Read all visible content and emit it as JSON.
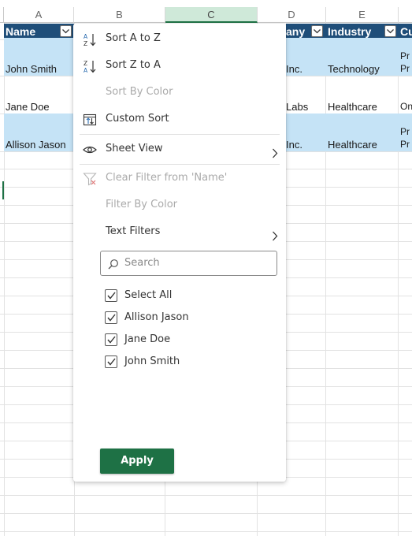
{
  "columns": [
    {
      "letter": "A",
      "active": false
    },
    {
      "letter": "B",
      "active": false
    },
    {
      "letter": "C",
      "active": true
    },
    {
      "letter": "D",
      "active": false
    },
    {
      "letter": "E",
      "active": false
    }
  ],
  "table": {
    "headers": {
      "name": "Name",
      "company_partial": "any",
      "industry": "Industry",
      "customer_partial": "Cu"
    },
    "rows": [
      {
        "name": "John Smith",
        "company_partial": "Inc.",
        "industry": "Technology",
        "extra_line1": "Pr",
        "extra_line2": "Pr",
        "banded": true
      },
      {
        "name": "Jane Doe",
        "company_partial": "Labs",
        "industry": "Healthcare",
        "extra_line1": "On",
        "extra_line2": "",
        "banded": false
      },
      {
        "name": "Allison Jason",
        "company_partial": "Inc.",
        "industry": "Healthcare",
        "extra_line1": "Pr",
        "extra_line2": "Pr",
        "banded": true
      }
    ]
  },
  "menu": {
    "sort_az": "Sort A to Z",
    "sort_za": "Sort Z to A",
    "sort_by_color": "Sort By Color",
    "custom_sort": "Custom Sort",
    "sheet_view": "Sheet View",
    "clear_filter": "Clear Filter from 'Name'",
    "filter_by_color": "Filter By Color",
    "text_filters": "Text Filters",
    "search_placeholder": "Search",
    "checklist": [
      {
        "label": "Select All",
        "checked": true
      },
      {
        "label": "Allison Jason",
        "checked": true
      },
      {
        "label": "Jane Doe",
        "checked": true
      },
      {
        "label": "John Smith",
        "checked": true
      }
    ],
    "apply": "Apply"
  },
  "colors": {
    "header_fill": "#1f4e79",
    "band_fill": "#c5e3f6",
    "accent_green": "#1e7145",
    "active_col_fill": "#cfe9d9"
  },
  "icons": [
    "sort-ascending-icon",
    "sort-descending-icon",
    "custom-sort-icon",
    "eye-icon",
    "chevron-right-icon",
    "clear-filter-icon",
    "search-icon",
    "checkmark-icon",
    "dropdown-arrow-icon"
  ]
}
